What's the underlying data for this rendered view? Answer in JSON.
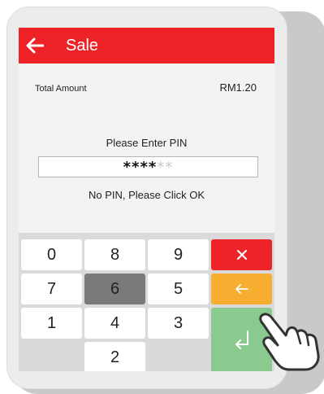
{
  "header": {
    "title": "Sale",
    "back_icon": "arrow-left-icon",
    "color": "#ee2328"
  },
  "transaction": {
    "total_label": "Total Amount",
    "total_value": "RM1.20"
  },
  "pin": {
    "prompt": "Please Enter PIN",
    "filled_mask": "****",
    "empty_mask": "**",
    "no_pin_hint": "No PIN, Please Click OK"
  },
  "keypad": {
    "keys": {
      "k0": "0",
      "k8": "8",
      "k9": "9",
      "k7": "7",
      "k6": "6",
      "k5": "5",
      "k1": "1",
      "k4": "4",
      "k3": "3",
      "k2": "2"
    },
    "pressed_key": "6",
    "cancel_icon": "close-icon",
    "backspace_icon": "arrow-left-icon",
    "ok_icon": "enter-return-icon",
    "colors": {
      "cancel": "#ee2328",
      "backspace": "#f7ad2f",
      "ok": "#8bca8f",
      "pressed": "#7a7a7a"
    }
  },
  "pointer": {
    "icon": "hand-pointer-icon"
  }
}
